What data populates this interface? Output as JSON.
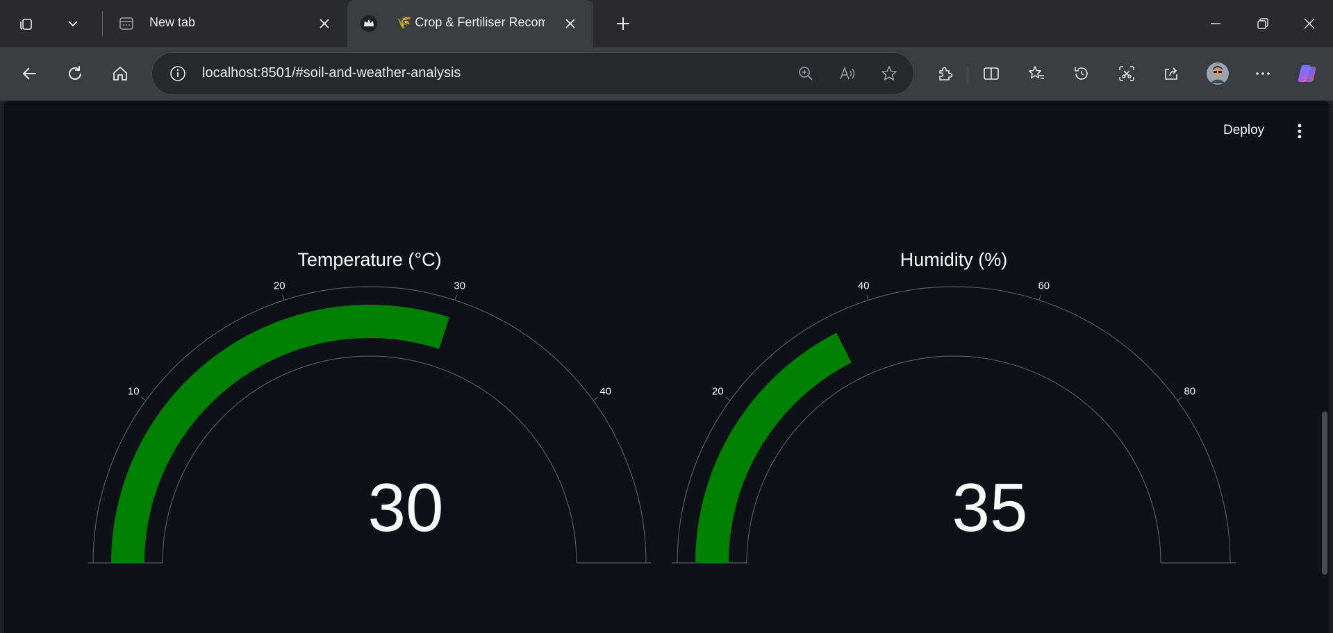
{
  "browser": {
    "tabs": [
      {
        "title": "New tab",
        "active": false
      },
      {
        "title": "🌾 Crop & Fertiliser Recom",
        "active": true
      }
    ],
    "url": "localhost:8501/#soil-and-weather-analysis"
  },
  "app": {
    "deploy_label": "Deploy",
    "colors": {
      "background": "#0e1117",
      "bar": "#008000",
      "axis": "#555a60",
      "text": "#fafafa"
    }
  },
  "gauges": [
    {
      "title": "Temperature (°C)",
      "value_text": "30",
      "value": 30,
      "range": [
        0,
        50
      ],
      "ticks": [
        "10",
        "20",
        "30",
        "40"
      ],
      "tick_values": [
        10,
        20,
        30,
        40
      ]
    },
    {
      "title": "Humidity (%)",
      "value_text": "35",
      "value": 35,
      "range": [
        0,
        100
      ],
      "ticks": [
        "20",
        "40",
        "60",
        "80"
      ],
      "tick_values": [
        20,
        40,
        60,
        80
      ]
    }
  ]
}
